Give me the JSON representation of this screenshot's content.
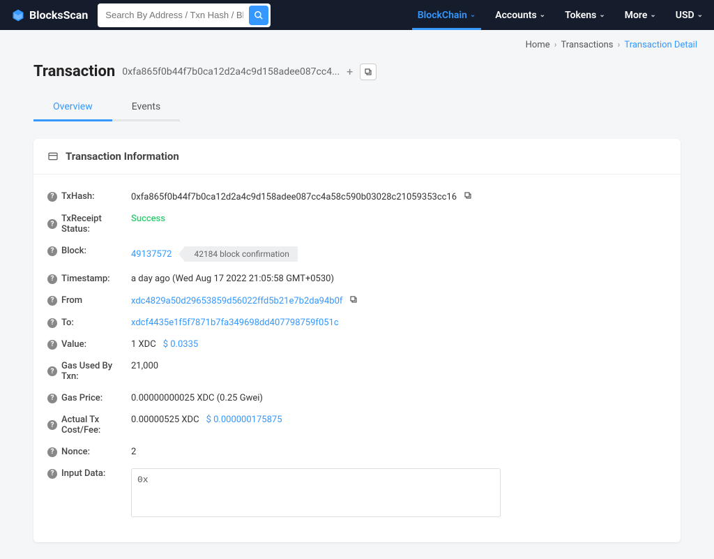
{
  "brand": "BlocksScan",
  "search": {
    "placeholder": "Search By Address / Txn Hash / Block..."
  },
  "nav": {
    "blockchain": "BlockChain",
    "accounts": "Accounts",
    "tokens": "Tokens",
    "more": "More",
    "currency": "USD"
  },
  "breadcrumb": {
    "home": "Home",
    "transactions": "Transactions",
    "detail": "Transaction Detail"
  },
  "title": {
    "heading": "Transaction",
    "hash_short": "0xfa865f0b44f7b0ca12d2a4c9d158adee087cc4..."
  },
  "tabs": {
    "overview": "Overview",
    "events": "Events"
  },
  "card": {
    "heading": "Transaction Information",
    "labels": {
      "txhash": "TxHash:",
      "receipt": "TxReceipt Status:",
      "block": "Block:",
      "timestamp": "Timestamp:",
      "from": "From",
      "to": "To:",
      "value": "Value:",
      "gas_used": "Gas Used By Txn:",
      "gas_price": "Gas Price:",
      "cost": "Actual Tx Cost/Fee:",
      "nonce": "Nonce:",
      "input": "Input Data:"
    },
    "values": {
      "txhash": "0xfa865f0b44f7b0ca12d2a4c9d158adee087cc4a58c590b03028c21059353cc16",
      "receipt": "Success",
      "block": "49137572",
      "block_confirm": "42184 block confirmation",
      "timestamp": "a day ago (Wed Aug 17 2022 21:05:58 GMT+0530)",
      "from": "xdc4829a50d29653859d56022ffd5b21e7b2da94b0f",
      "to": "xdcf4435e1f5f7871b7fa349698dd407798759f051c",
      "value": "1 XDC",
      "value_usd": "$ 0.0335",
      "gas_used": "21,000",
      "gas_price": "0.00000000025 XDC (0.25 Gwei)",
      "cost": "0.00000525 XDC",
      "cost_usd": "$ 0.000000175875",
      "nonce": "2",
      "input": "0x"
    }
  }
}
